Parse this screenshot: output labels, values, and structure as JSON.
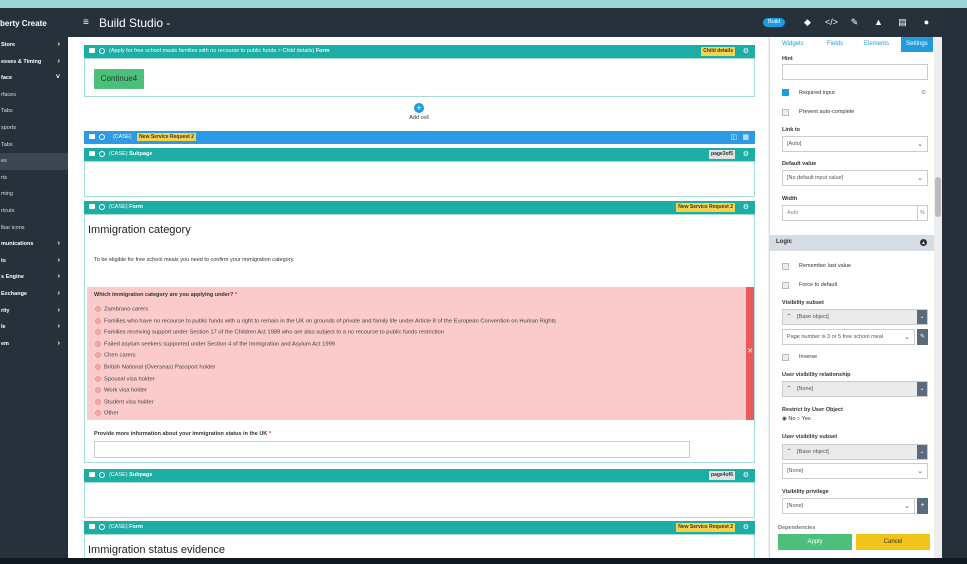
{
  "app": {
    "brand": "berty Create",
    "title": "Build Studio -",
    "build_badge": "Build"
  },
  "sidebar": {
    "items": [
      {
        "label": "Store",
        "chevron": true,
        "style": "bold"
      },
      {
        "label": "esses & Timing",
        "chevron": true,
        "style": "bold"
      },
      {
        "label": "face",
        "chevron": true,
        "style": "bold",
        "expanded": true
      },
      {
        "label": "rfaces",
        "chevron": false,
        "style": "light"
      },
      {
        "label": "Tabs",
        "chevron": false,
        "style": "light"
      },
      {
        "label": "sports",
        "chevron": false,
        "style": "light"
      },
      {
        "label": "Tabs",
        "chevron": false,
        "style": "light"
      },
      {
        "label": "es",
        "chevron": false,
        "style": "light",
        "active": true
      },
      {
        "label": "rts",
        "chevron": false,
        "style": "light"
      },
      {
        "label": "ming",
        "chevron": false,
        "style": "light"
      },
      {
        "label": "rtcuts",
        "chevron": false,
        "style": "light"
      },
      {
        "label": "lbar icons",
        "chevron": false,
        "style": "light"
      },
      {
        "label": "munications",
        "chevron": true,
        "style": "bold"
      },
      {
        "label": "ts",
        "chevron": true,
        "style": "bold"
      },
      {
        "label": "s Engine",
        "chevron": true,
        "style": "bold"
      },
      {
        "label": "Exchange",
        "chevron": true,
        "style": "bold"
      },
      {
        "label": "rity",
        "chevron": true,
        "style": "bold"
      },
      {
        "label": "le",
        "chevron": true,
        "style": "bold"
      },
      {
        "label": "em",
        "chevron": true,
        "style": "bold"
      }
    ]
  },
  "canvas": {
    "bar1": {
      "text": "(Apply for free school meals families with no recourse to public funds > Child details)",
      "kind": "Form",
      "tag": "Child details"
    },
    "continue_label": "Continue4",
    "add_cell_label": "Add cell",
    "bar2": {
      "text": "(CASE)",
      "tag": "New Service Request 2"
    },
    "bar3": {
      "text": "(CASE)",
      "kind": "Subpage",
      "tag": "page3of5"
    },
    "bar4": {
      "text": "(CASE)",
      "kind": "Form",
      "tag": "New Service Request 2"
    },
    "heading1": "Immigration category",
    "intro": "To be eligible for free school meals you need to confirm your immigration category.",
    "question": "Which immigration category are you applying under?",
    "required_mark": "*",
    "options": [
      "Zambrano carers",
      "Families who have no recourse to public funds with a right to remain in the UK on grounds of private and family life under Article 8 of the European Convention on Human Rights",
      "Families receiving support under Section 17 of the Children Act 1989 who are also subject to a no recourse to public funds restriction",
      "Failed asylum seekers supported under Section 4 of the Immigration and Asylum Act 1999",
      "Chen carers",
      "British National (Overseas) Passport holder",
      "Spousal visa holder",
      "Work visa holder",
      "Student visa holder",
      "Other"
    ],
    "more_info_label": "Provide more information about your immigration status in the UK",
    "bar5": {
      "text": "(CASE)",
      "kind": "Subpage",
      "tag": "page4of6"
    },
    "bar6": {
      "text": "(CASE)",
      "kind": "Form",
      "tag": "New Service Request 2"
    },
    "heading2": "Immigration status evidence"
  },
  "right_panel": {
    "tabs": [
      "Widgets",
      "Fields",
      "Elements",
      "Settings"
    ],
    "selected_tab": "Settings",
    "hint_label": "Hint",
    "required_label": "Required input",
    "required_checked": true,
    "prevent_autocomplete_label": "Prevent auto-complete",
    "link_to_label": "Link to",
    "link_to_value": "[Auto]",
    "default_value_label": "Default value",
    "default_value_value": "[No default input value]",
    "width_label": "Width",
    "width_value": "Auto",
    "width_unit": "%",
    "logic_label": "Logic",
    "remember_label": "Remember last value",
    "force_default_label": "Force to default",
    "visibility_subset_label": "Visibility subset",
    "visibility_subset_value": "[Base object]",
    "visibility_rule_value": "Page number is 3 or 5 free school meal",
    "inverse_label": "Inverse",
    "user_vis_rel_label": "User visibility relationship",
    "user_vis_rel_value": "[None]",
    "restrict_label": "Restrict by User Object",
    "restrict_no": "No",
    "restrict_yes": "Yes",
    "user_vis_subset_label": "User visibility subset",
    "user_vis_subset_value": "[Base object]",
    "user_vis_subset_value2": "[None]",
    "vis_privilege_label": "Visibility privilege",
    "vis_privilege_value": "[None]",
    "dependencies_label": "Dependencies",
    "apply_label": "Apply",
    "cancel_label": "Cancel"
  },
  "colors": {
    "teal": "#1cada4",
    "blue": "#1f9be0",
    "green": "#4cc07a",
    "yellow": "#f0c418",
    "error_bg": "#fbcaca",
    "error_bar": "#ea5a5a",
    "dark": "#27313c"
  }
}
